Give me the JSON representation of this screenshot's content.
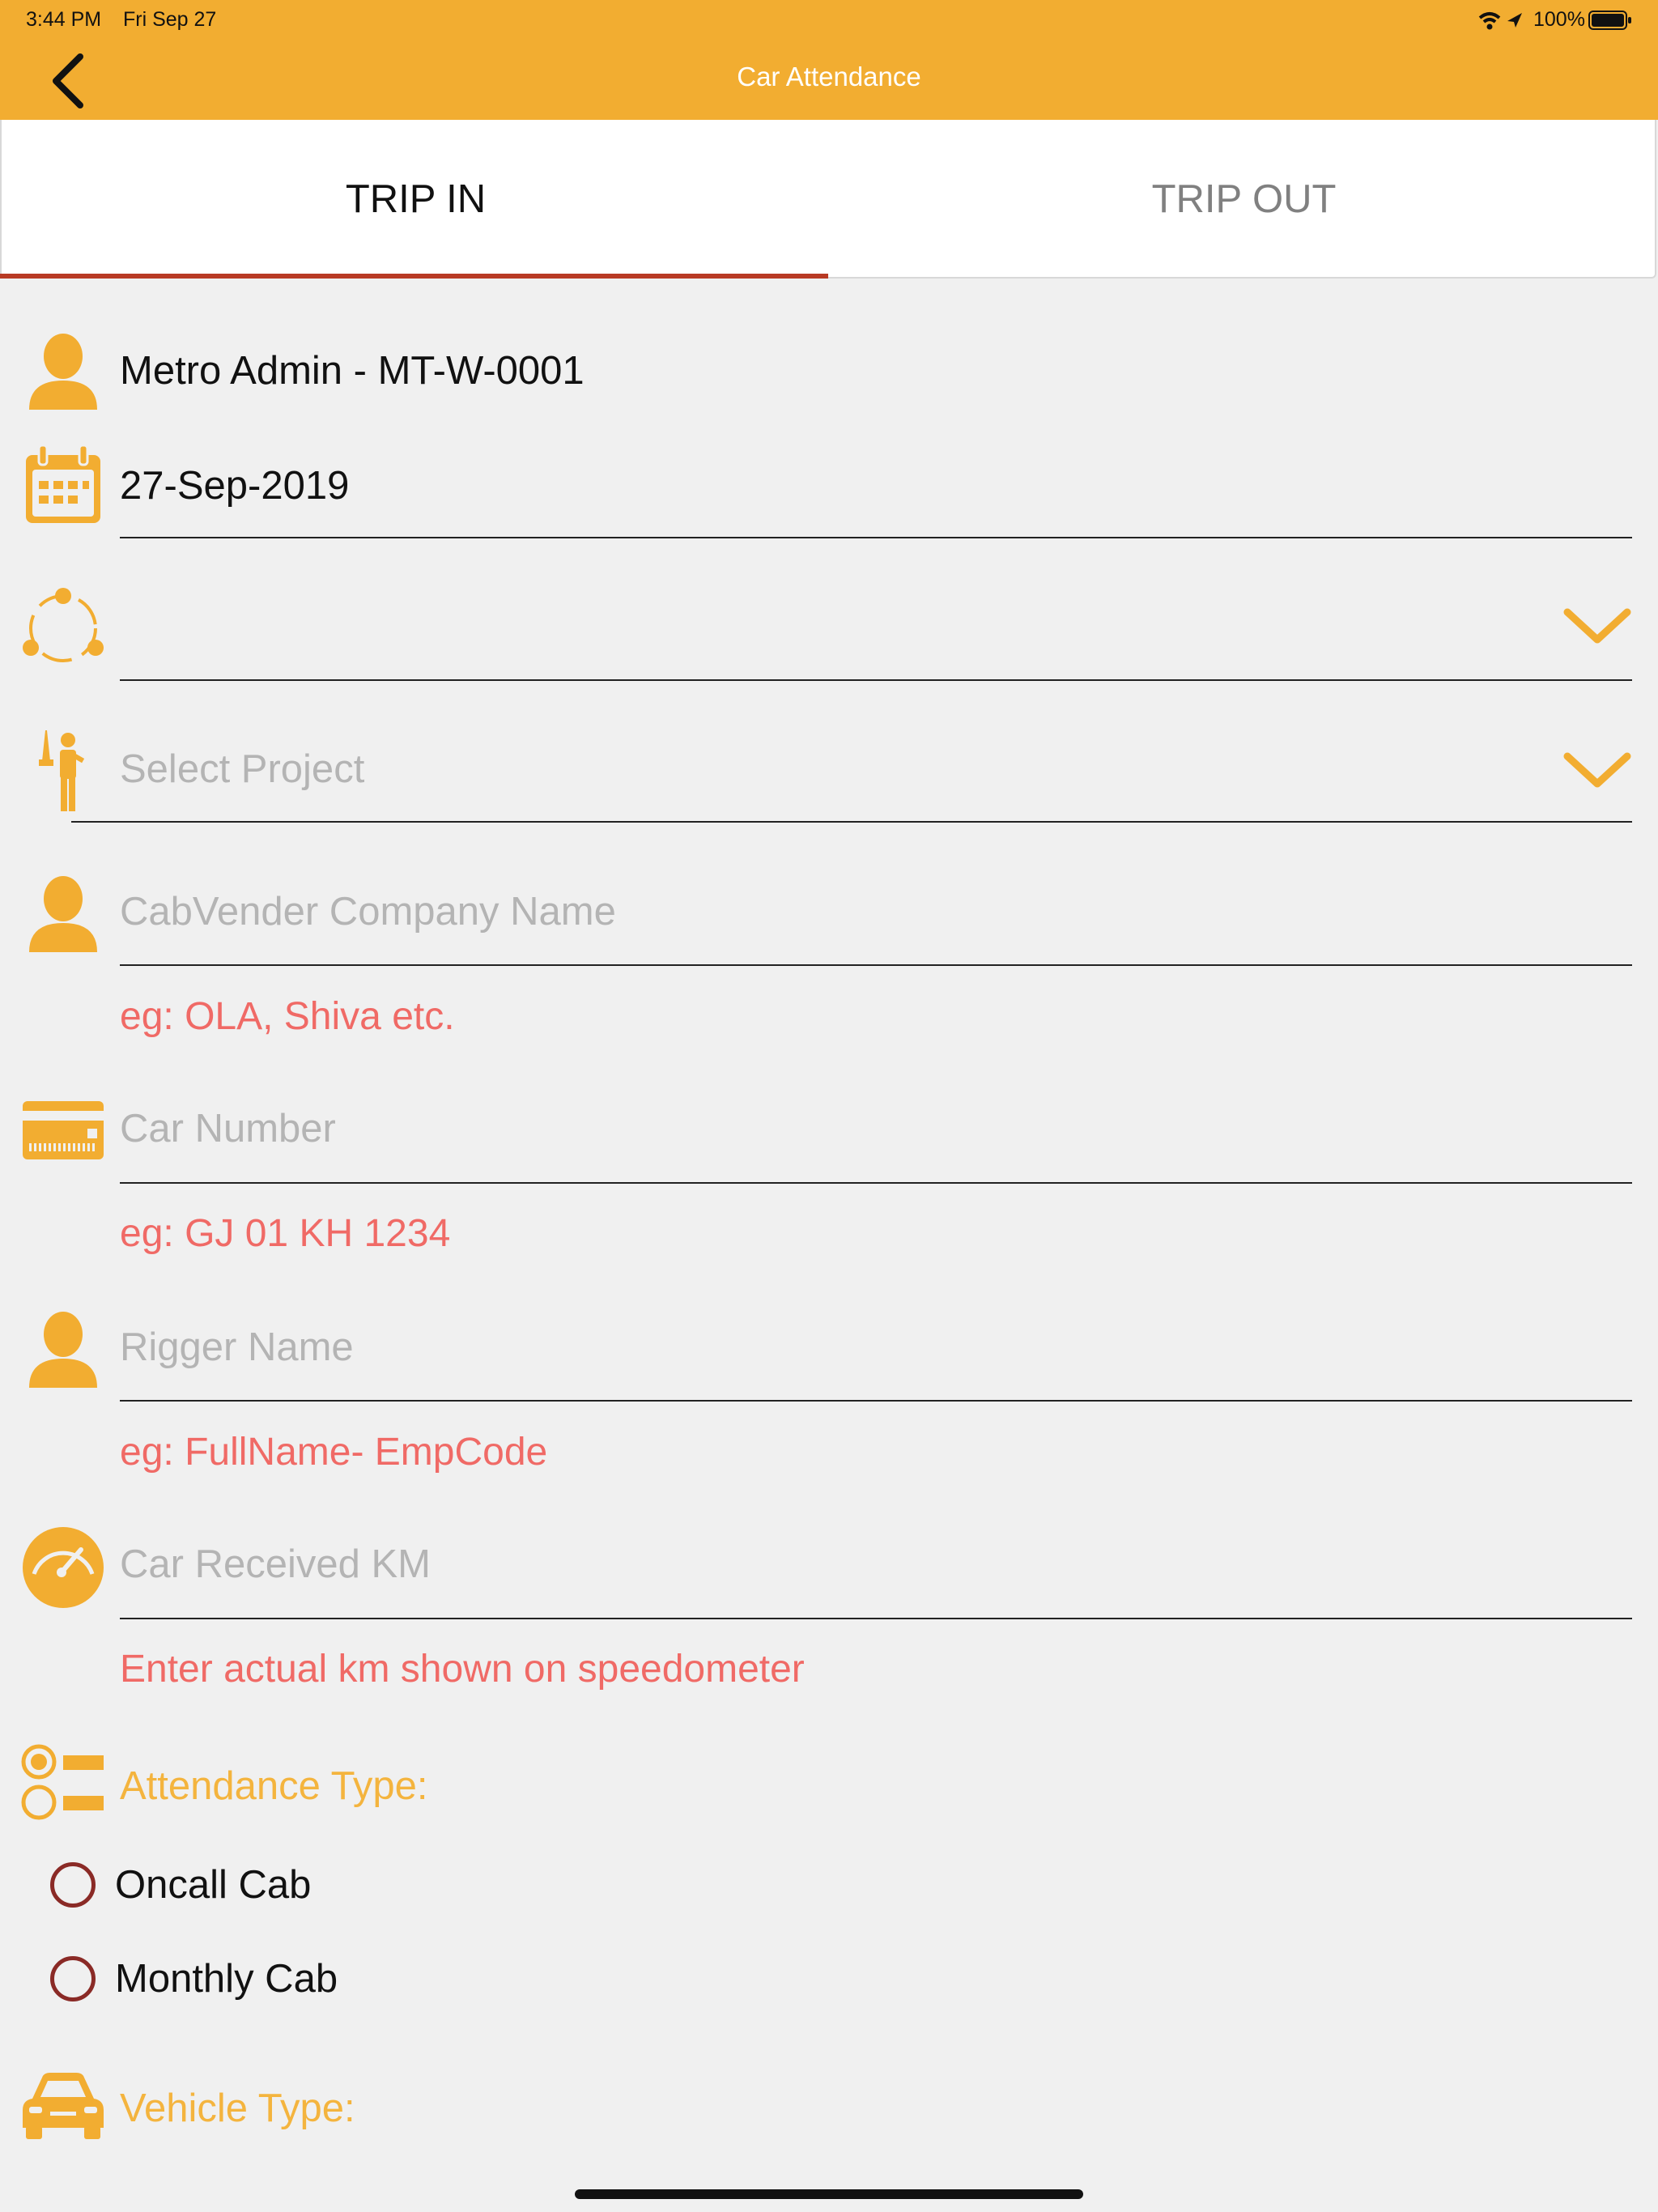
{
  "status_bar": {
    "time": "3:44 PM",
    "date": "Fri Sep 27",
    "battery": "100%"
  },
  "header": {
    "title": "Car Attendance",
    "back_icon": "chevron-left-icon"
  },
  "tabs": [
    {
      "label": "TRIP IN",
      "selected": true
    },
    {
      "label": "TRIP OUT",
      "selected": false
    }
  ],
  "form": {
    "user_name": "Metro Admin - MT-W-0001",
    "date": "27-Sep-2019",
    "group_value": "",
    "project_placeholder": "Select Project",
    "vendor_placeholder": "CabVender Company Name",
    "vendor_hint": "eg: OLA, Shiva etc.",
    "car_number_placeholder": "Car Number",
    "car_number_hint": "eg: GJ 01 KH 1234",
    "rigger_placeholder": "Rigger Name",
    "rigger_hint": "eg: FullName- EmpCode",
    "km_placeholder": "Car Received KM",
    "km_hint": "Enter actual km shown on speedometer",
    "attendance_label": "Attendance Type:",
    "attendance_options": [
      "Oncall Cab",
      "Monthly Cab"
    ],
    "vehicle_label": "Vehicle Type:"
  },
  "colors": {
    "accent": "#f2ad31",
    "hint": "#f06a66",
    "tab_indicator": "#b83a24",
    "radio": "#8a2a26"
  }
}
